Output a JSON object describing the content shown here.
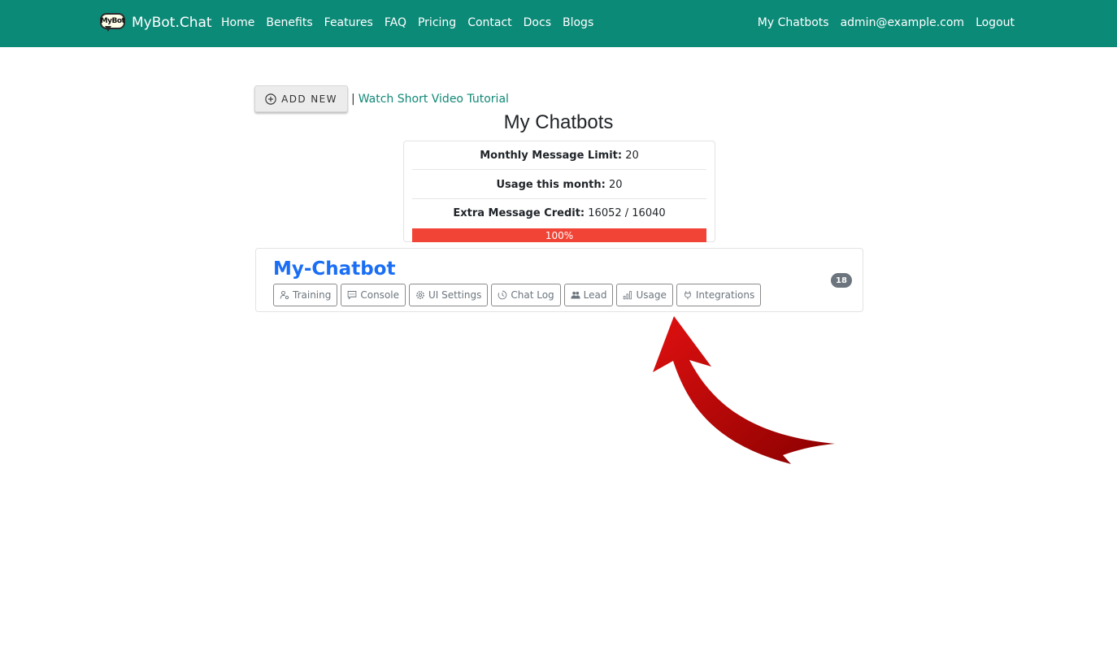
{
  "brand": {
    "logo_text": "MyBot",
    "name": "MyBot.Chat"
  },
  "nav": {
    "left": [
      "Home",
      "Benefits",
      "Features",
      "FAQ",
      "Pricing",
      "Contact",
      "Docs",
      "Blogs"
    ],
    "right": [
      "My Chatbots",
      "admin@example.com",
      "Logout"
    ]
  },
  "toolbar": {
    "add_label": "ADD NEW",
    "separator": "|",
    "tutorial_label": "Watch Short Video Tutorial"
  },
  "page": {
    "title": "My Chatbots"
  },
  "stats": {
    "monthly_limit_label": "Monthly Message Limit:",
    "monthly_limit_value": "20",
    "usage_label": "Usage this month:",
    "usage_value": "20",
    "extra_credit_label": "Extra Message Credit:",
    "extra_credit_value": "16052 / 16040",
    "progress_label": "100%",
    "progress_fraction": 1.0,
    "progress_color": "#f14436"
  },
  "bot": {
    "name": "My-Chatbot",
    "badge": "18",
    "actions": [
      {
        "label": "Training",
        "icon": "person-gear-icon"
      },
      {
        "label": "Console",
        "icon": "chat-dots-icon"
      },
      {
        "label": "UI Settings",
        "icon": "gear-icon"
      },
      {
        "label": "Chat Log",
        "icon": "clock-history-icon"
      },
      {
        "label": "Lead",
        "icon": "people-icon"
      },
      {
        "label": "Usage",
        "icon": "bar-chart-icon"
      },
      {
        "label": "Integrations",
        "icon": "plug-icon"
      }
    ]
  },
  "colors": {
    "navbar": "#0c8a78",
    "link": "#118876",
    "bot_name": "#1a6ef5",
    "arrow": "#d10b0b"
  }
}
